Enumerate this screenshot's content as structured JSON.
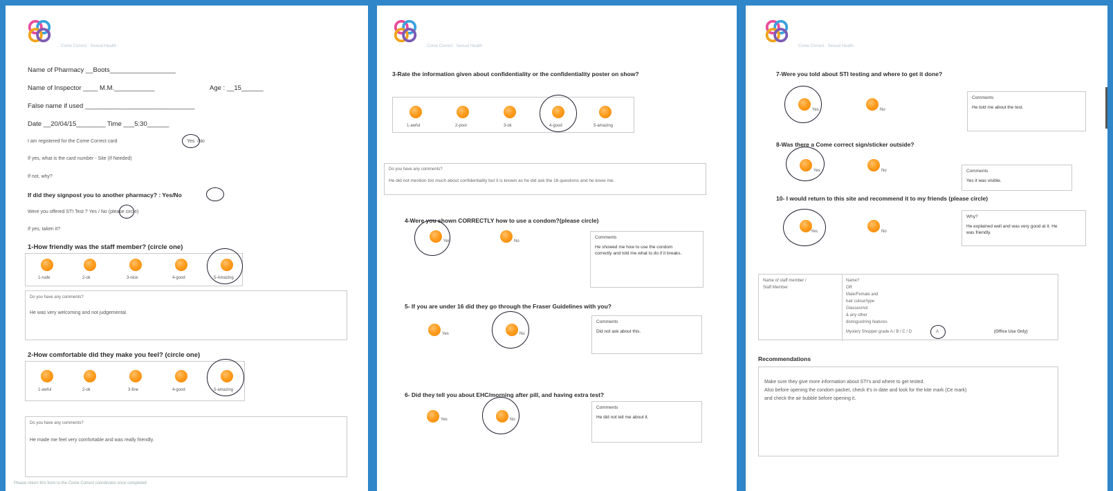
{
  "page1": {
    "fields": {
      "pharmacy": "Name of Pharmacy __Boots__________________",
      "inspector": "Name of Inspector ____ M.M.___________",
      "age": "Age : __15______",
      "false_name": "False name if used ______________________________",
      "date_time": "Date __20/04/15________ Time ___5:30______",
      "registered": "I am registered for the Come Correct card",
      "registered_yes": "Yes",
      "registered_no": "/No",
      "stated": "If yes, what is the card number - Site (If Needed)",
      "if_no": "If not, why?",
      "signpost": "If did they signpost you to another pharmacy? : Yes/No",
      "sti_kit": "Were you offered STI Test ? Yes / No (please circle)",
      "kit_taken": "If yes, taken it?"
    },
    "q1": {
      "title": "1-How friendly was the staff member? (circle one)",
      "options": [
        "1-rude",
        "2-ok",
        "3-nice",
        "4-good",
        "5-Amazing"
      ],
      "selected": 5,
      "comment_header": "Do you have any comments?",
      "comment": "He was very welcoming and not judgemental."
    },
    "q2": {
      "title": "2-How comfortable did they make you feel? (circle one)",
      "options": [
        "1-awful",
        "2-ok",
        "3-fine",
        "4-good",
        "5-amazing"
      ],
      "selected": 5,
      "comment_header": "Do you have any comments?",
      "comment": "He made me feel very comfortable and was really friendly."
    },
    "footer": "Please return this form to the Come Correct coordinator once completed"
  },
  "page2": {
    "q3": {
      "title": "3-Rate the information given about confidentiality or the confidentiality poster on show?",
      "options": [
        "1-awful",
        "2-poor",
        "3-ok",
        "4-good",
        "5-amazing"
      ],
      "selected": 4,
      "comment_header": "Do you have any comments?",
      "comment": "He did not mention too much about confidentiality but it is known as he did ask the 16 questions and he knew me."
    },
    "q4": {
      "title": "4-Were you shown CORRECTLY how to use a condom?(please circle)",
      "options": [
        "Yes",
        "No"
      ],
      "selected": 1,
      "comment_header": "Comments",
      "comment": "He showed me how to use the condom correctly and told me what to do if it breaks."
    },
    "q5": {
      "title": "5- If you are under 16 did they go through the Fraser Guidelines with you?",
      "options": [
        "Yes",
        "No"
      ],
      "selected": 2,
      "comment_header": "Comments",
      "comment": "Did not ask about this."
    },
    "q6": {
      "title": "6- Did they tell you about EHC/morning after pill, and having extra test?",
      "options": [
        "Yes",
        "No"
      ],
      "selected": 2,
      "comment_header": "Comments",
      "comment": "He did not tell me about it."
    }
  },
  "page3": {
    "q7": {
      "title": "7-Were you told about STI testing and where to get it done?",
      "options": [
        "Yes",
        "No"
      ],
      "selected": 1,
      "comment_header": "Comments",
      "comment": "He told me about the test."
    },
    "q8": {
      "title": "8-Was there a Come correct sign/sticker outside?",
      "options": [
        "Yes",
        "No"
      ],
      "selected": 1,
      "comment_header": "Comments",
      "comment": "Yes it was visible."
    },
    "q9": {
      "title": "10- I would return to this site and recommend it to my friends (please circle)",
      "options": [
        "Yes",
        "No"
      ],
      "selected": 1,
      "comment_header": "Why?",
      "comment": "He explained well and was very good at it. He was friendly."
    },
    "admin": {
      "left_1": "Name of staff member /",
      "left_2": "Staff Member",
      "right_lines": [
        "Name?",
        "OR",
        "Male/Female and",
        "hair colour/type",
        "Glasses/not",
        "& any other",
        "distinguishing features"
      ],
      "bottom": "Mystery Shopper grade  A / B / C / D",
      "bottom_circled": "A",
      "signature_label": "(Office Use Only)"
    },
    "recommendations": {
      "title": "Recommendations",
      "lines": [
        "Make sure they give more information about STI's and where to get tested.",
        "Also before opening the condom packet, check it's in date and look for the kite mark (Ce mark)",
        "and check the air bubble before opening it."
      ]
    }
  }
}
